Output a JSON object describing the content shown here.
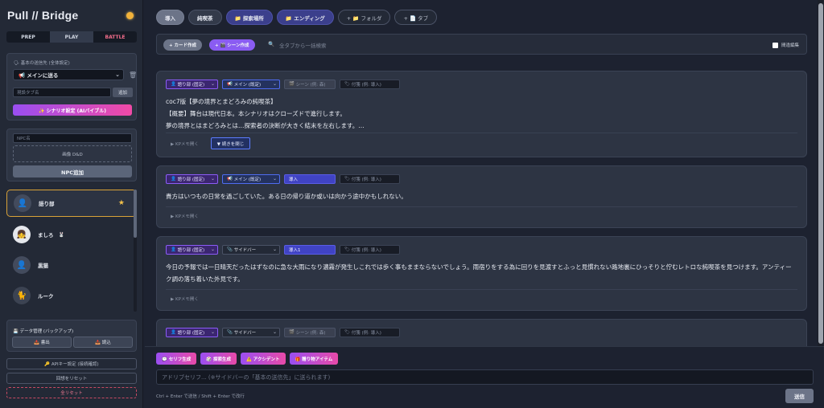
{
  "app": {
    "title": "Pull // Bridge"
  },
  "modes": [
    "PREP",
    "PLAY",
    "BATTLE"
  ],
  "send_target": {
    "label": "🗣 基本の送信先 (全体設定)",
    "selected": "📢 メインに送る",
    "tab_placeholder": "現設タブ名",
    "add_label": "追加",
    "generate_label": "✨ シナリオ設定 (AIバイブル)"
  },
  "npc_form": {
    "name_placeholder": "NPC名",
    "image_drop": "画像 D&D",
    "add_button": "NPC追加"
  },
  "npcs": [
    {
      "name": "語り部",
      "starred": true
    },
    {
      "name": "ましろ",
      "tag": "🐰"
    },
    {
      "name": "黒猫"
    },
    {
      "name": "ルーク"
    }
  ],
  "data_mgmt": {
    "label": "💾 データ管理 (バックアップ)",
    "export_label": "📤 書出",
    "import_label": "📥 読込"
  },
  "sidebar_buttons": {
    "api_settings": "🔑 APIキー設定 (接続確認)",
    "reset_progress": "回想をリセット",
    "full_reset": "全リセット"
  },
  "tabs": [
    {
      "label": "導入"
    },
    {
      "label": "純喫茶"
    },
    {
      "label": "📁 探索場所"
    },
    {
      "label": "📁 エンディング"
    },
    {
      "label": "+ 📁 フォルダ"
    },
    {
      "label": "+ 📄 タブ"
    }
  ],
  "toolbar": {
    "add_card": "+ カード作成",
    "add_scene": "+ 🎬 シーン作成",
    "search_placeholder": "全タブから一括検索",
    "bulk_edit_label": "間違編集"
  },
  "scenes": [
    {
      "speaker": "語り部 (固定)",
      "channel": "メイン (既定)",
      "scene": "シーン (例: 森)",
      "tag": "付箋 (例: 導入)",
      "text": "coc7版【夢の境界とまどろみの純喫茶】\n【概要】舞台は現代日本。本シナリオはクローズドで進行します。\n夢の境界とはまどろみとは…探索者の決断が大きく結末を左右します。…",
      "kp_label": "▶ KPメモ開く",
      "collapse_label": "▼ 続きを閉じ"
    },
    {
      "speaker": "語り部 (固定)",
      "channel": "メイン (既定)",
      "scene": "導入",
      "tag": "付箋 (例: 導入)",
      "text": "貴方はいつもの日常を過ごしていた。ある日の帰り道か或いは向かう途中かもしれない。",
      "kp_label": "▶ KPメモ開く"
    },
    {
      "speaker": "語り部 (固定)",
      "channel": "サイドバー",
      "scene": "導入1",
      "tag": "付箋 (例: 導入)",
      "text": "今日の予報では一日晴天だったはずなのに急な大雨になり濃霧が発生しこれでは歩く事もままならないでしょう。雨宿りをする為に回りを見渡すとふっと見慣れない路地裏にひっそりと佇むレトロな純喫茶を見つけます。アンティーク調の落ち着いた外見です。",
      "kp_label": "▶ KPメモ開く"
    },
    {
      "speaker": "語り部 (固定)",
      "channel": "サイドバー",
      "scene": "シーン (例: 森)",
      "tag": "付箋 (例: 導入)",
      "text": "",
      "kp_label": ""
    }
  ],
  "actions": [
    "💬 セリフ生成",
    "🎲 探索生成",
    "⚠️ アクシデント",
    "🎁 贈り物アイテム"
  ],
  "composer": {
    "placeholder": "アドリブセリフ... (※サイドバーの「基本の送信先」に送られます)",
    "hint": "Ctrl + Enter で送信 / Shift + Enter で改行",
    "send_label": "送信"
  },
  "colors": {
    "accent": "#8b5cf6",
    "star": "#f4c14a",
    "danger": "#c94a62",
    "background": "#1d2230"
  }
}
